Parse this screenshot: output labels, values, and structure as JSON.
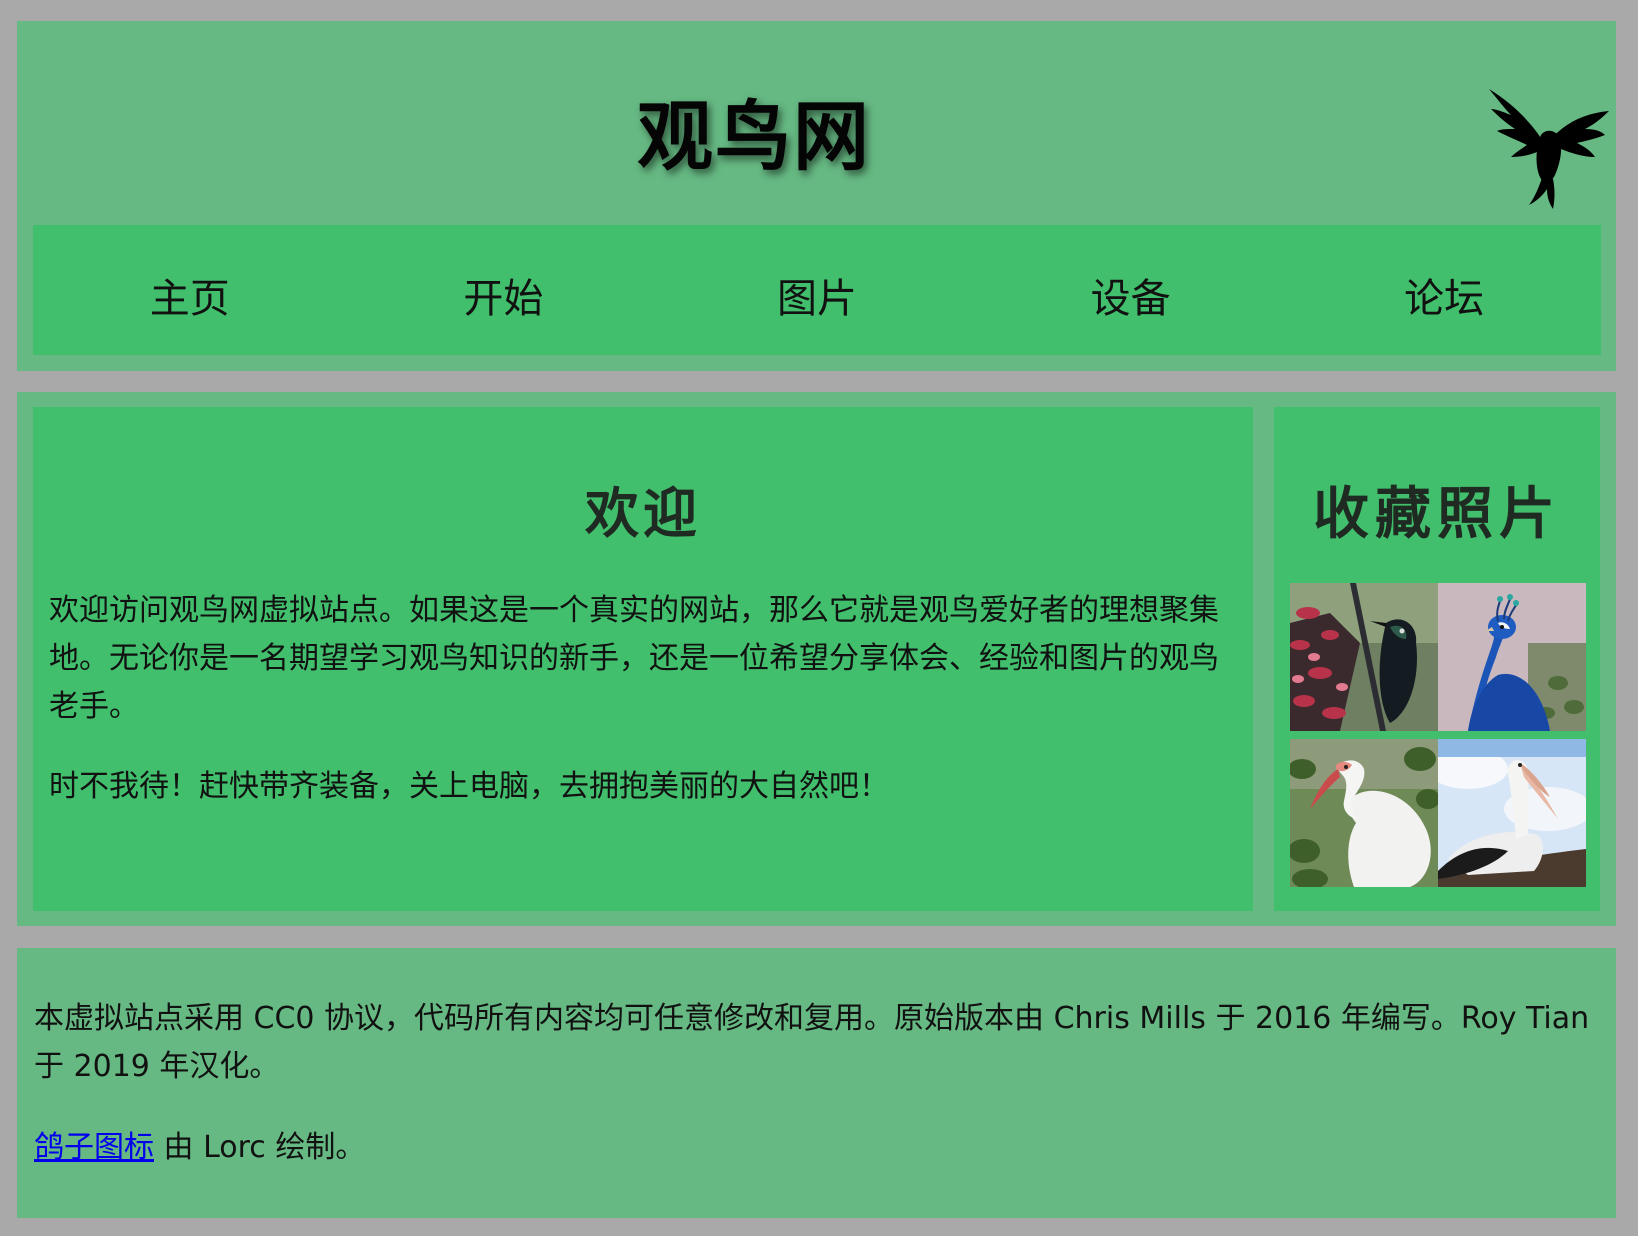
{
  "header": {
    "title": "观鸟网",
    "logo_icon": "bird-icon"
  },
  "nav": {
    "items": [
      {
        "label": "主页"
      },
      {
        "label": "开始"
      },
      {
        "label": "图片"
      },
      {
        "label": "设备"
      },
      {
        "label": "论坛"
      }
    ]
  },
  "main": {
    "welcome": {
      "heading": "欢迎",
      "paragraphs": [
        "欢迎访问观鸟网虚拟站点。如果这是一个真实的网站，那么它就是观鸟爱好者的理想聚集地。无论你是一名期望学习观鸟知识的新手，还是一位希望分享体会、经验和图片的观鸟老手。",
        "时不我待！赶快带齐装备，关上电脑，去拥抱美丽的大自然吧！"
      ]
    },
    "gallery": {
      "heading": "收藏照片",
      "photos": [
        {
          "subject": "tui-bird-photo"
        },
        {
          "subject": "peacock-photo"
        },
        {
          "subject": "white-ibis-photo"
        },
        {
          "subject": "pelican-photo"
        }
      ]
    }
  },
  "footer": {
    "license_text": "本虚拟站点采用 CC0 协议，代码所有内容均可任意修改和复用。原始版本由 Chris Mills 于 2016 年编写。Roy Tian 于 2019 年汉化。",
    "credit_link_text": "鸽子图标",
    "credit_rest_text": " 由 Lorc 绘制。"
  },
  "colors": {
    "page_background": "#a9a9a9",
    "panel_background": "#66b983",
    "box_background": "#41bf6c",
    "link": "#0000ee"
  }
}
